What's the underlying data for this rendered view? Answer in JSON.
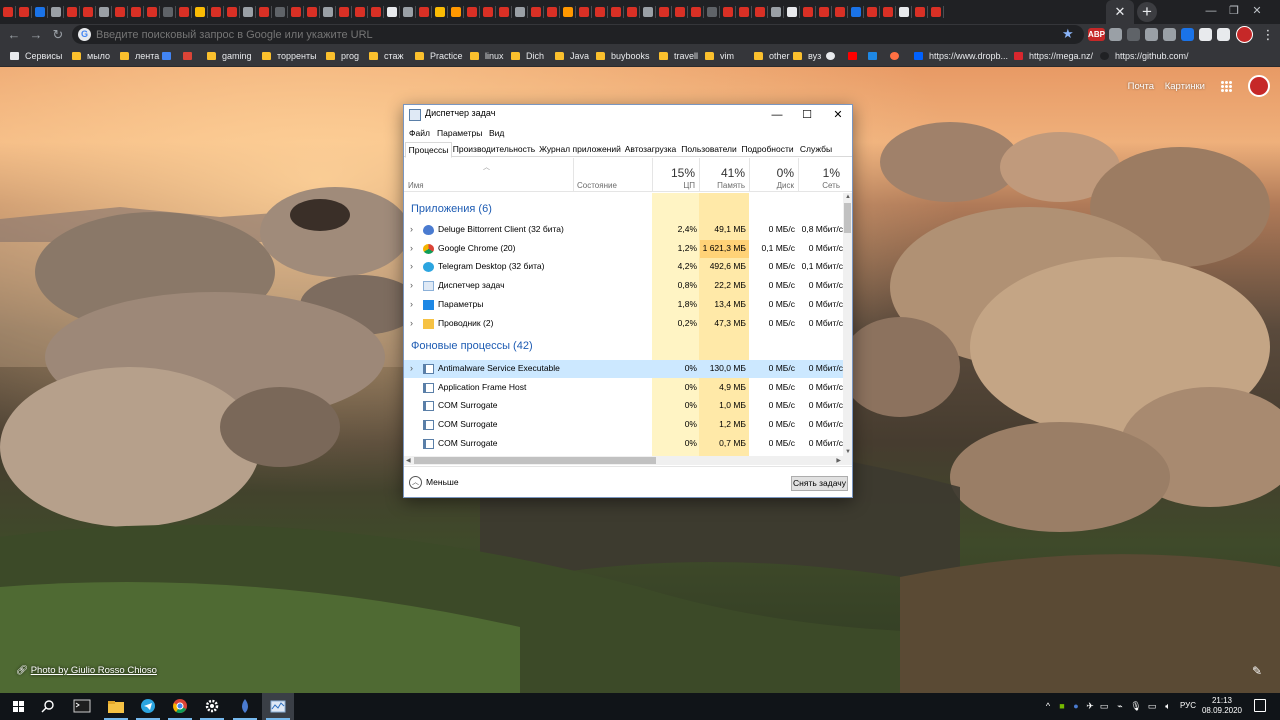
{
  "chrome": {
    "window_controls": {
      "minimize": "—",
      "maximize": "❐",
      "close": "✕"
    },
    "tab_close": "✕",
    "new_tab": "+",
    "omnibox": {
      "placeholder": "Введите поисковый запрос в Google или укажите URL",
      "g": "G"
    },
    "extensions": [
      {
        "text": "ABP",
        "color": "#c62828"
      },
      {
        "text": "",
        "color": "#9aa0a6"
      },
      {
        "text": "",
        "color": "#5f6368"
      },
      {
        "text": "",
        "color": "#9aa0a6"
      },
      {
        "text": "",
        "color": "#9aa0a6"
      },
      {
        "text": "",
        "color": "#1a73e8"
      },
      {
        "text": "",
        "color": "#e8eaed"
      },
      {
        "text": "",
        "color": "#e8eaed"
      }
    ],
    "tab_favicon_colors": [
      "#d93025",
      "#d93025",
      "#1a73e8",
      "#9aa0a6",
      "#d93025",
      "#d93025",
      "#9aa0a6",
      "#d93025",
      "#d93025",
      "#d93025",
      "#5f6368",
      "#d93025",
      "#fbbc04",
      "#d93025",
      "#d93025",
      "#9aa0a6",
      "#d93025",
      "#5f6368",
      "#d93025",
      "#d93025",
      "#9aa0a6",
      "#d93025",
      "#d93025",
      "#d93025",
      "#e8eaed",
      "#9aa0a6",
      "#d93025",
      "#fbbc04",
      "#ff9800",
      "#d93025",
      "#d93025",
      "#d93025",
      "#9aa0a6",
      "#d93025",
      "#d93025",
      "#ff9800",
      "#d93025",
      "#d93025",
      "#d93025",
      "#d93025",
      "#9aa0a6",
      "#d93025",
      "#d93025",
      "#d93025",
      "#5f6368",
      "#d93025",
      "#d93025",
      "#d93025",
      "#9aa0a6",
      "#e8eaed",
      "#d93025",
      "#d93025",
      "#d93025",
      "#1a73e8",
      "#d93025",
      "#d93025",
      "#e8eaed",
      "#d93025",
      "#d93025"
    ],
    "bookmarks": [
      {
        "label": "Сервисы",
        "kind": "apps"
      },
      {
        "label": "мыло",
        "kind": "folder"
      },
      {
        "label": "лента",
        "kind": "folder"
      },
      {
        "label": "",
        "kind": "translate"
      },
      {
        "label": "",
        "kind": "star"
      },
      {
        "label": "gaming",
        "kind": "folder"
      },
      {
        "label": "торренты",
        "kind": "folder"
      },
      {
        "label": "prog",
        "kind": "folder"
      },
      {
        "label": "стаж",
        "kind": "folder"
      },
      {
        "label": "Practice",
        "kind": "folder"
      },
      {
        "label": "linux",
        "kind": "folder"
      },
      {
        "label": "Dich",
        "kind": "folder"
      },
      {
        "label": "Java",
        "kind": "folder"
      },
      {
        "label": "buybooks",
        "kind": "folder"
      },
      {
        "label": "travell",
        "kind": "folder"
      },
      {
        "label": "vim",
        "kind": "folder"
      },
      {
        "label": "other",
        "kind": "folder"
      },
      {
        "label": "вуз",
        "kind": "folder"
      },
      {
        "label": "",
        "kind": "play"
      },
      {
        "label": "",
        "kind": "youtube"
      },
      {
        "label": "",
        "kind": "paypal"
      },
      {
        "label": "",
        "kind": "orange"
      },
      {
        "label": "https://www.dropb...",
        "kind": "dropbox"
      },
      {
        "label": "https://mega.nz/",
        "kind": "mega"
      },
      {
        "label": "https://github.com/",
        "kind": "github"
      }
    ]
  },
  "ntp": {
    "mail": "Почта",
    "images": "Картинки",
    "photo_credit_prefix": "",
    "photo_credit": "Photo by Giulio Rosso Chioso"
  },
  "taskmgr": {
    "title": "Диспетчер задач",
    "menu": [
      "Файл",
      "Параметры",
      "Вид"
    ],
    "tabs": [
      "Процессы",
      "Производительность",
      "Журнал приложений",
      "Автозагрузка",
      "Пользователи",
      "Подробности",
      "Службы"
    ],
    "columns": {
      "name": "Имя",
      "status": "Состояние",
      "cpu": {
        "pct": "15%",
        "label": "ЦП"
      },
      "mem": {
        "pct": "41%",
        "label": "Память"
      },
      "disk": {
        "pct": "0%",
        "label": "Диск"
      },
      "net": {
        "pct": "1%",
        "label": "Сеть"
      }
    },
    "groups": {
      "apps": "Приложения (6)",
      "bg": "Фоновые процессы (42)"
    },
    "apps": [
      {
        "name": "Deluge Bittorrent Client (32 бита)",
        "cpu": "2,4%",
        "mem": "49,1 МБ",
        "disk": "0 МБ/с",
        "net": "0,8 Мбит/с",
        "icon": "deluge"
      },
      {
        "name": "Google Chrome (20)",
        "cpu": "1,2%",
        "mem": "1 621,3 МБ",
        "disk": "0,1 МБ/с",
        "net": "0 Мбит/с",
        "icon": "chrome"
      },
      {
        "name": "Telegram Desktop (32 бита)",
        "cpu": "4,2%",
        "mem": "492,6 МБ",
        "disk": "0 МБ/с",
        "net": "0,1 Мбит/с",
        "icon": "telegram"
      },
      {
        "name": "Диспетчер задач",
        "cpu": "0,8%",
        "mem": "22,2 МБ",
        "disk": "0 МБ/с",
        "net": "0 Мбит/с",
        "icon": "taskmgr"
      },
      {
        "name": "Параметры",
        "cpu": "1,8%",
        "mem": "13,4 МБ",
        "disk": "0 МБ/с",
        "net": "0 Мбит/с",
        "icon": "settings"
      },
      {
        "name": "Проводник (2)",
        "cpu": "0,2%",
        "mem": "47,3 МБ",
        "disk": "0 МБ/с",
        "net": "0 Мбит/с",
        "icon": "explorer"
      }
    ],
    "bg": [
      {
        "name": "Antimalware Service Executable",
        "cpu": "0%",
        "mem": "130,0 МБ",
        "disk": "0 МБ/с",
        "net": "0 Мбит/с",
        "expandable": true
      },
      {
        "name": "Application Frame Host",
        "cpu": "0%",
        "mem": "4,9 МБ",
        "disk": "0 МБ/с",
        "net": "0 Мбит/с",
        "expandable": false
      },
      {
        "name": "COM Surrogate",
        "cpu": "0%",
        "mem": "1,0 МБ",
        "disk": "0 МБ/с",
        "net": "0 Мбит/с",
        "expandable": false
      },
      {
        "name": "COM Surrogate",
        "cpu": "0%",
        "mem": "1,2 МБ",
        "disk": "0 МБ/с",
        "net": "0 Мбит/с",
        "expandable": false
      },
      {
        "name": "COM Surrogate",
        "cpu": "0%",
        "mem": "0,7 МБ",
        "disk": "0 МБ/с",
        "net": "0 Мбит/с",
        "expandable": false
      }
    ],
    "fewer": "Меньше",
    "end_task": "Снять задачу",
    "colors": {
      "cpu_col": "#fff4c4",
      "mem_col": "#ffe9a8",
      "mem_hot": "#ffd277",
      "group": "#1e5cb3",
      "selected": "#cce8ff"
    }
  },
  "taskbar": {
    "lang": "РУС",
    "time": "21:13",
    "date": "08.09.2020"
  }
}
